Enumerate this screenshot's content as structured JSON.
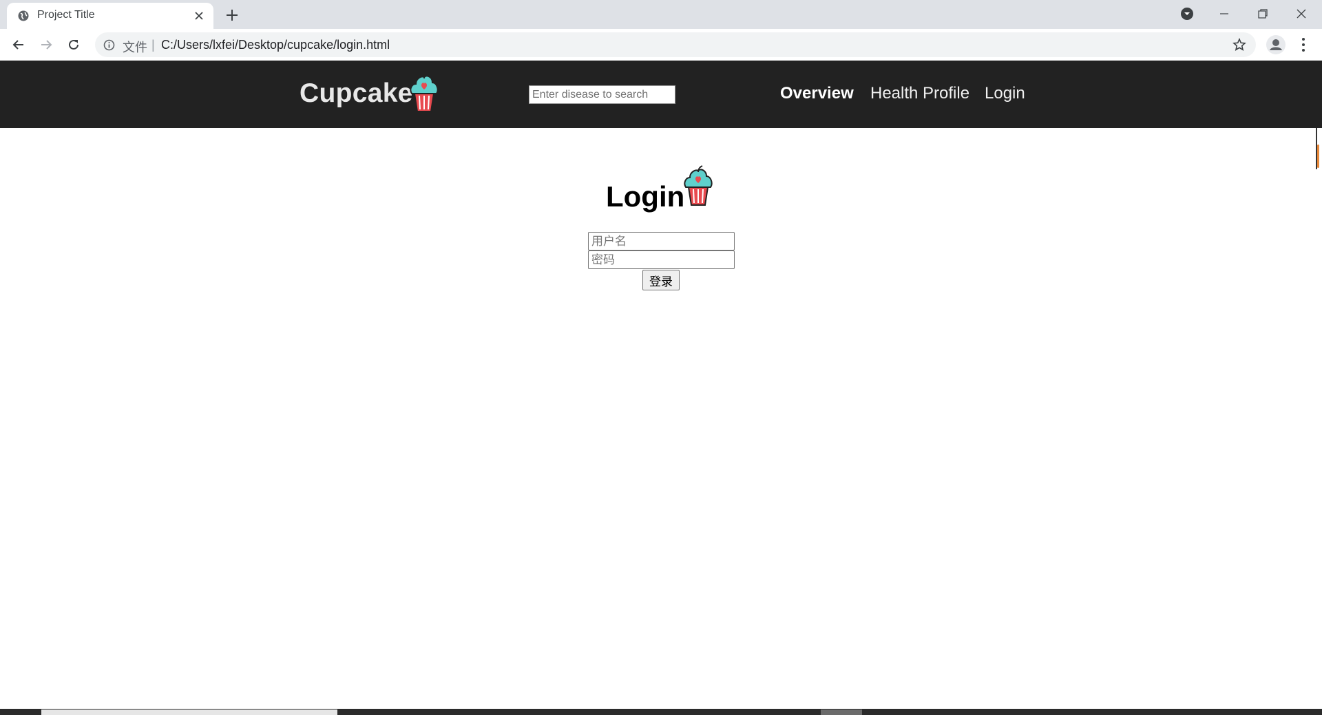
{
  "browser": {
    "tab_title": "Project Title",
    "scheme_label": "文件",
    "separator": "|",
    "url": "C:/Users/lxfei/Desktop/cupcake/login.html"
  },
  "header": {
    "brand": "Cupcake",
    "search_placeholder": "Enter disease to search",
    "nav": {
      "overview": "Overview",
      "health_profile": "Health Profile",
      "login": "Login"
    }
  },
  "login": {
    "title": "Login",
    "username_placeholder": "用户名",
    "password_placeholder": "密码",
    "submit_label": "登录"
  },
  "colors": {
    "header_bg": "#222222",
    "cupcake_frosting": "#5fd0cc",
    "cupcake_wrapper": "#e84a4f"
  },
  "icons": {
    "favicon": "globe-icon",
    "logo": "cupcake-icon"
  }
}
